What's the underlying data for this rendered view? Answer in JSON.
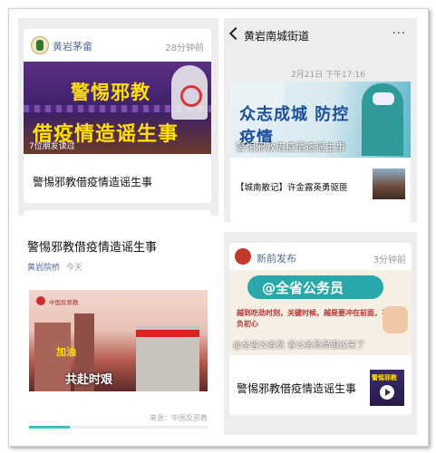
{
  "p1": {
    "account": "黄岩茅畲",
    "time": "28分钟前",
    "headline_line1": "警惕邪教",
    "headline_line2": "借疫情造谣生事",
    "readers": "7位朋友读过",
    "title": "警惕邪教借疫情造谣生事"
  },
  "p2": {
    "nav_title": "黄岩南城街道",
    "datetime": "2月21日 下午17:16",
    "banner_text": "众志成城 防控疫情",
    "banner_caption": "警惕邪教借疫情造谣生事",
    "item_text": "【城南散记】许金露英勇驱匪"
  },
  "p3": {
    "title": "警惕邪教借疫情造谣生事",
    "author": "黄岩院桥",
    "date": "今天",
    "video_brand": "中国反邪教",
    "sign_text": "加油",
    "video_caption": "共赴时艰",
    "source": "来源：中国反邪教"
  },
  "p4": {
    "account": "新前发布",
    "time": "3分钟前",
    "banner_title": "@全省公务员",
    "handwriting": "越到吃劲时刻，关键时候，越是要冲在前面，不负初心",
    "banner_caption": "@全省公务员 省公务员局倡议来了",
    "title": "警惕邪教借疫情造谣生事",
    "thumb_text": "警惕邪教"
  },
  "colors": {
    "link": "#576b95",
    "banner_purple": "#4b2a78",
    "headline_yellow": "#ffe000",
    "teal": "#2e9a9a"
  }
}
